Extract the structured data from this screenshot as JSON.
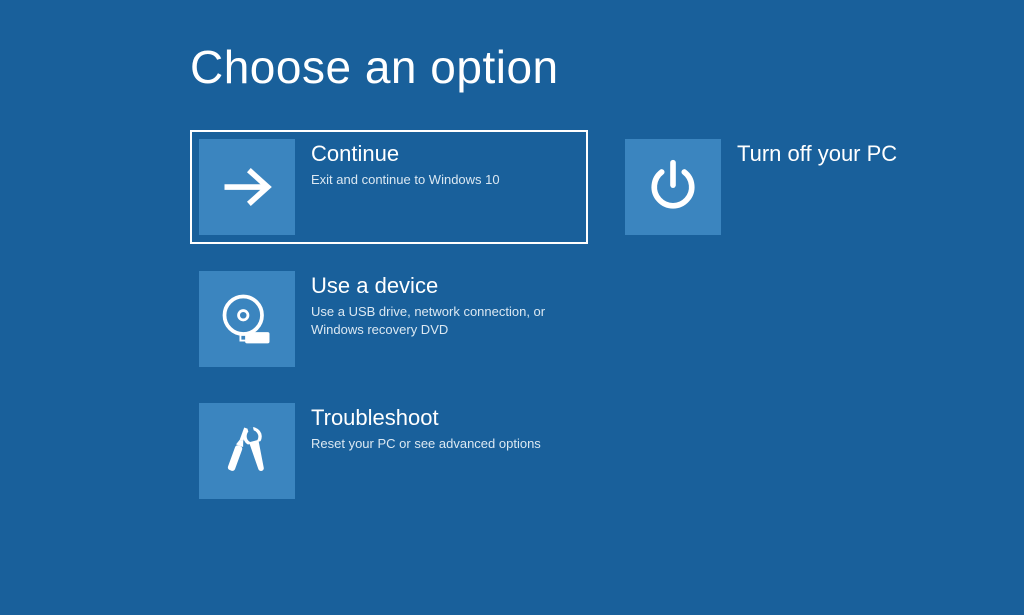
{
  "title": "Choose an option",
  "options": {
    "continue": {
      "title": "Continue",
      "desc": "Exit and continue to Windows 10"
    },
    "use_device": {
      "title": "Use a device",
      "desc": "Use a USB drive, network connection, or Windows recovery DVD"
    },
    "troubleshoot": {
      "title": "Troubleshoot",
      "desc": "Reset your PC or see advanced options"
    },
    "turn_off": {
      "title": "Turn off your PC"
    }
  }
}
